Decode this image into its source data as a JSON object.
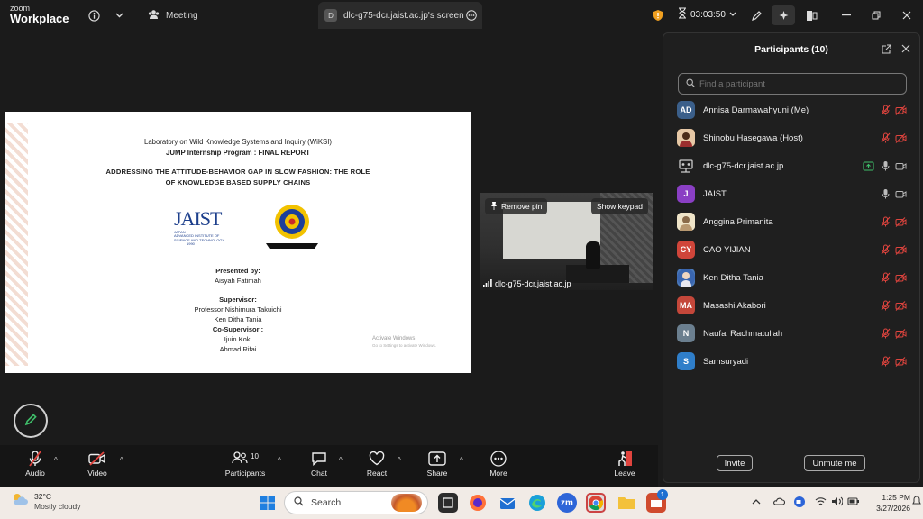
{
  "app": {
    "logo_line1": "zoom",
    "logo_line2": "Workplace",
    "meeting_tab": "Meeting",
    "screen_tab": "dlc-g75-dcr.jaist.ac.jp's screen",
    "screen_tab_letter": "D",
    "timer": "03:03:50"
  },
  "slide": {
    "lab": "Laboratory on Wild Knowledge Systems and Inquiry (WiKSI)",
    "program": "JUMP Internship Program : FINAL REPORT",
    "title_line1": "ADDRESSING THE ATTITUDE-BEHAVIOR GAP IN SLOW FASHION: THE ROLE",
    "title_line2": "OF KNOWLEDGE BASED SUPPLY CHAINS",
    "logo_text": "JAIST",
    "logo_sub1": "JAPAN",
    "logo_sub2": "ADVANCED INSTITUTE OF",
    "logo_sub3": "SCIENCE AND TECHNOLOGY",
    "logo_year": "1990",
    "presented_by": "Presented by:",
    "presenter": "Aisyah Fatimah",
    "supervisor_label": "Supervisor:",
    "supervisor1": "Professor Nishimura Takuichi",
    "supervisor2": "Ken Ditha Tania",
    "cosupervisor_label": "Co-Supervisor :",
    "cosupervisor1": "Ijuin Koki",
    "cosupervisor2": "Ahmad Rifai",
    "watermark1": "Activate Windows",
    "watermark2": "Go to Settings to activate Windows."
  },
  "video": {
    "remove_pin": "Remove pin",
    "show_keypad": "Show keypad",
    "name": "dlc-g75-dcr.jaist.ac.jp"
  },
  "participants": {
    "title": "Participants (10)",
    "search_placeholder": "Find a participant",
    "list": [
      {
        "initials": "AD",
        "name": "Annisa Darmawahyuni (Me)",
        "color": "#3b5f8a",
        "muted": true,
        "video_off": true
      },
      {
        "initials": "",
        "name": "Shinobu Hasegawa (Host)",
        "color": "#c07a3a",
        "muted": true,
        "video_off": true
      },
      {
        "initials": "",
        "name": "dlc-g75-dcr.jaist.ac.jp",
        "color": "#333333",
        "muted": false,
        "video_off": false,
        "sharing": true
      },
      {
        "initials": "J",
        "name": "JAIST",
        "color": "#8a3fc4",
        "muted": false,
        "video_off": false
      },
      {
        "initials": "",
        "name": "Anggina Primanita",
        "color": "#d8c9a8",
        "muted": true,
        "video_off": true
      },
      {
        "initials": "CY",
        "name": "CAO YIJIAN",
        "color": "#d0453a",
        "muted": true,
        "video_off": true
      },
      {
        "initials": "",
        "name": "Ken Ditha Tania",
        "color": "#4a78b8",
        "muted": true,
        "video_off": true
      },
      {
        "initials": "MA",
        "name": "Masashi Akabori",
        "color": "#c4473a",
        "muted": true,
        "video_off": true
      },
      {
        "initials": "N",
        "name": "Naufal Rachmatullah",
        "color": "#6b7f8f",
        "muted": true,
        "video_off": true
      },
      {
        "initials": "S",
        "name": "Samsuryadi",
        "color": "#2f7ec9",
        "muted": true,
        "video_off": true
      }
    ],
    "invite": "Invite",
    "unmute_me": "Unmute me"
  },
  "toolbar": {
    "audio": "Audio",
    "video": "Video",
    "participants": "Participants",
    "participants_count": "10",
    "chat": "Chat",
    "react": "React",
    "share": "Share",
    "more": "More",
    "leave": "Leave"
  },
  "taskbar": {
    "temp": "32°C",
    "weather": "Mostly cloudy",
    "search": "Search",
    "time": "1:25 PM",
    "date": "3/27/2026",
    "badge": "1"
  },
  "colors": {
    "accent_red": "#e0443e",
    "accent_green": "#3fbf6a",
    "panel_bg": "#1f1f1f"
  }
}
